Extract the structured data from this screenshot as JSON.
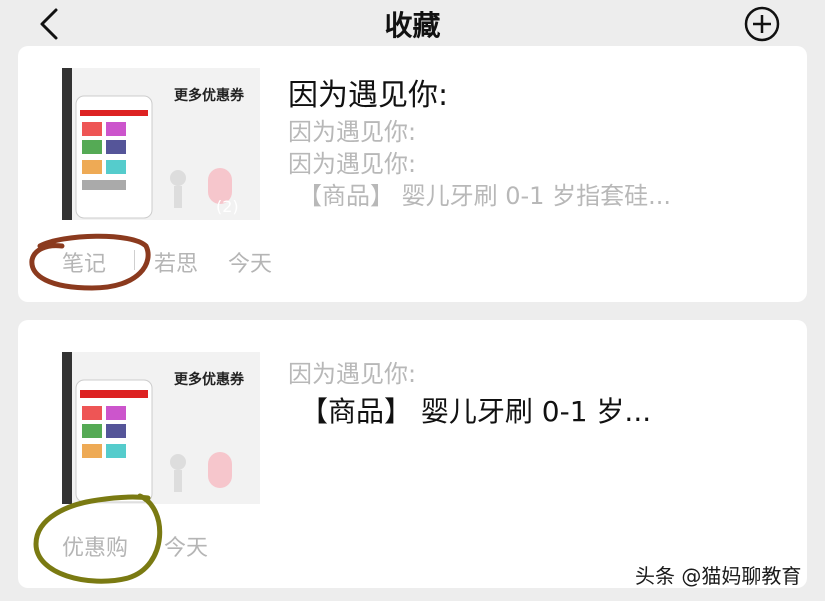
{
  "navbar": {
    "title": "收藏",
    "back_icon": "chevron-left-icon",
    "add_icon": "plus-circle-icon"
  },
  "cards": [
    {
      "title": "因为遇见你:",
      "lines": [
        "因为遇见你:",
        "因为遇见你:",
        "【商品】 婴儿牙刷 0-1 岁指套硅..."
      ],
      "thumb_count": "(2)",
      "thumb_headline": "更多优惠券",
      "type_label": "笔记",
      "author": "若思",
      "time": "今天",
      "annotation_color": "#8b3a1e"
    },
    {
      "subtitle": "因为遇见你:",
      "product": "【商品】 婴儿牙刷 0-1 岁...",
      "thumb_headline": "更多优惠券",
      "type_label": "优惠购",
      "time": "今天",
      "annotation_color": "#7a7a12"
    }
  ],
  "watermark": "头条 @猫妈聊教育"
}
